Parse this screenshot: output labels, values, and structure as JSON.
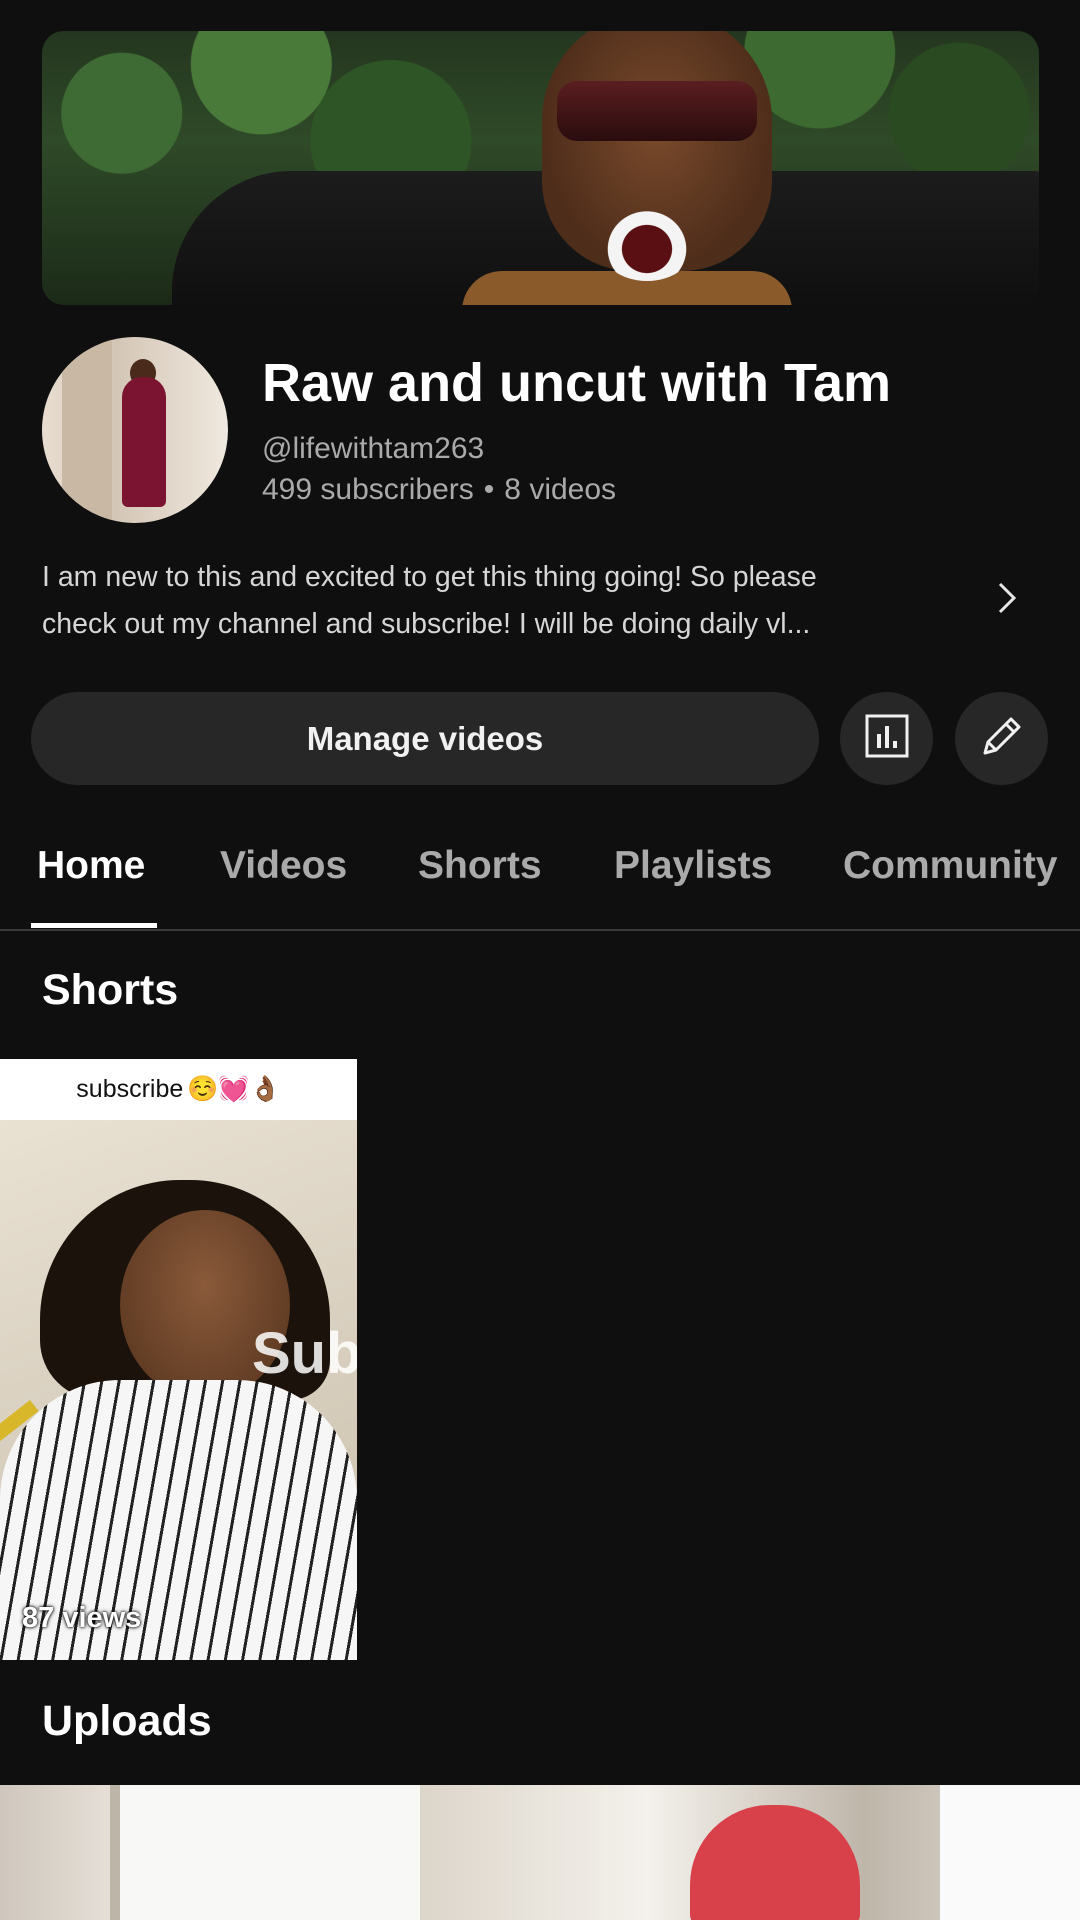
{
  "channel": {
    "title": "Raw and uncut with Tam",
    "handle": "@lifewithtam263",
    "subscribers": "499 subscribers",
    "separator": "•",
    "videos": "8 videos",
    "description_line1": "I am new to this and excited to get this thing going! So please",
    "description_line2": "check out my channel  and subscribe! I will be doing daily vl..."
  },
  "actions": {
    "manage_videos": "Manage videos",
    "analytics_icon": "bar-chart-icon",
    "edit_icon": "pencil-icon"
  },
  "tabs": [
    {
      "label": "Home",
      "active": true
    },
    {
      "label": "Videos",
      "active": false
    },
    {
      "label": "Shorts",
      "active": false
    },
    {
      "label": "Playlists",
      "active": false
    },
    {
      "label": "Community",
      "active": false
    }
  ],
  "sections": {
    "shorts_title": "Shorts",
    "uploads_title": "Uploads"
  },
  "short": {
    "caption": "subscribe",
    "caption_emojis": "☺️💓👌🏾",
    "overlay_text": "Sub",
    "views": "87 views"
  },
  "colors": {
    "background": "#0f0f0f",
    "button_bg": "#272727",
    "secondary_text": "#aaaaaa"
  }
}
